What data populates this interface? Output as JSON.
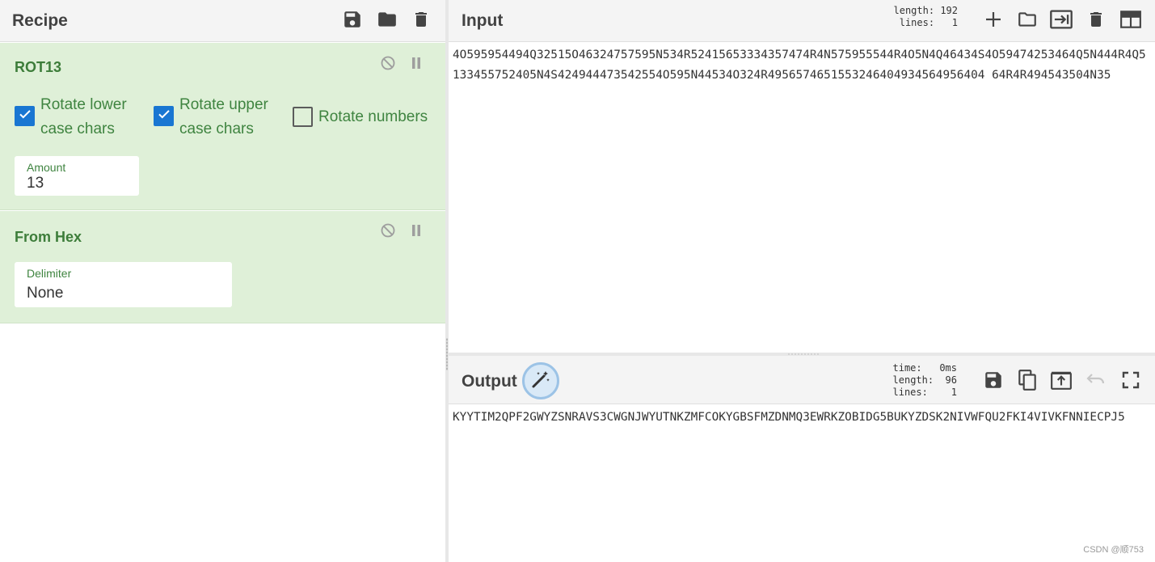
{
  "recipe": {
    "title": "Recipe",
    "header_icons": [
      "save-icon",
      "folder-icon",
      "trash-icon"
    ],
    "operations": [
      {
        "name": "ROT13",
        "controls": [
          "disable-icon",
          "pause-icon"
        ],
        "checkboxes": [
          {
            "label_line1": "Rotate lower",
            "label_line2": "case chars",
            "checked": true
          },
          {
            "label_line1": "Rotate upper",
            "label_line2": "case chars",
            "checked": true
          },
          {
            "label_line1": "Rotate numbers",
            "label_line2": "",
            "checked": false
          }
        ],
        "amount_label": "Amount",
        "amount_value": "13"
      },
      {
        "name": "From Hex",
        "controls": [
          "disable-icon",
          "pause-icon"
        ],
        "delimiter_label": "Delimiter",
        "delimiter_value": "None"
      }
    ]
  },
  "input": {
    "title": "Input",
    "length_label": "length:",
    "length_value": "192",
    "lines_label": "lines:",
    "lines_value": "1",
    "header_icons": [
      "plus-icon",
      "folder-icon",
      "import-icon",
      "trash-icon",
      "layout-icon"
    ],
    "text": "4O595954494Q32515O46324757595N534R52415653334357474R4N575955544R4O5N4Q46434S4O59474253464Q5N444R4Q5133455752405N4S424944473542554O595N44534O324R4956574651553246404934564956404 64R4R494543504N35"
  },
  "output": {
    "title": "Output",
    "time_label": "time:",
    "time_value": "0ms",
    "length_label": "length:",
    "length_value": "96",
    "lines_label": "lines:",
    "lines_value": "1",
    "header_icons": [
      "save-icon",
      "copy-icon",
      "replace-input-icon",
      "undo-icon",
      "maximise-icon"
    ],
    "text": "KYYTIM2QPF2GWYZSNRAVS3CWGNJWYUTNKZMFCOKYGBSFMZDNMQ3EWRKZOBIDG5BUKYZDSK2NIVWFQU2FKI4VIVKFNNIECPJ5"
  },
  "watermark": "CSDN @顺753",
  "colors": {
    "accent_green": "#3f8440",
    "operation_bg": "#dff0d8",
    "checkbox_blue": "#1976d2",
    "header_bg": "#f4f4f4"
  }
}
